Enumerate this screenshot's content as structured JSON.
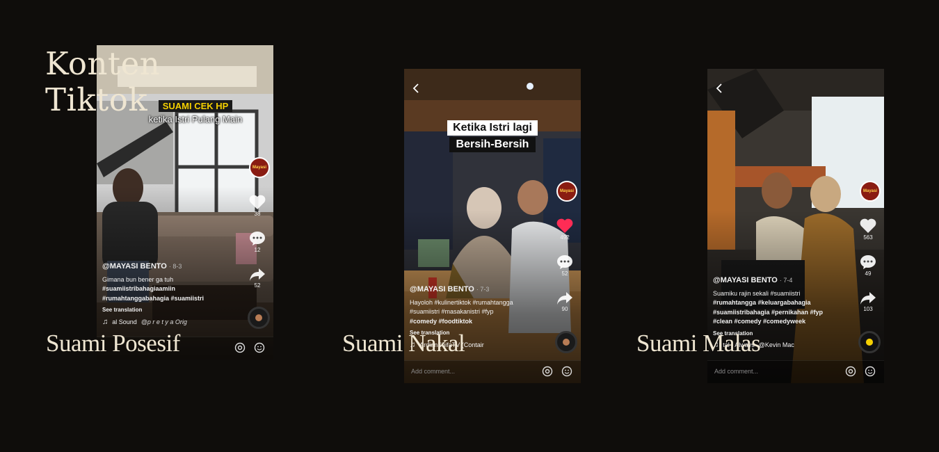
{
  "title": {
    "line1": "Konten",
    "line2": "Tiktok"
  },
  "videos": [
    {
      "caption": "Suami Posesif",
      "overlay": {
        "line1": "SUAMI CEK HP",
        "line2": "ketika Istri Pulang Main"
      },
      "avatar": "Mayasi",
      "actions": {
        "likes": "38",
        "comments": "12",
        "shares": "52"
      },
      "user": "@MAYASI BENTO",
      "date": "· 8-3",
      "desc_lines": [
        "Gimana bun bener ga tuh",
        "#suamiistribahagiaamiin",
        "#rumahtanggabahagia #suamiistri"
      ],
      "see_translation": "See translation",
      "sound": "al Sound",
      "sound_author": "@p r e t y a  Orig",
      "comment_placeholder": "",
      "colors": {
        "overlay1_bg": "#1a1a1a",
        "overlay1_fg": "#f5d000"
      }
    },
    {
      "caption": "Suami Nakal",
      "overlay": {
        "line1": "Ketika Istri lagi",
        "line2": "Bersih-Bersih"
      },
      "avatar": "Mayasi",
      "actions": {
        "likes": "492",
        "comments": "52",
        "shares": "90"
      },
      "user": "@MAYASI BENTO",
      "date": "· 7-3",
      "desc_lines": [
        "Hayoloh #kulinertiktok #rumahtangga",
        "#suamiistri #masakanistri #fyp",
        "#comedy #foodtiktok"
      ],
      "see_translation": "See translation",
      "sound": "ArdianShifaTV (Contair",
      "sound_author": "",
      "comment_placeholder": "Add comment...",
      "colors": {
        "like": "#fe2c55"
      }
    },
    {
      "caption": "Suami Malas",
      "overlay": {
        "line1": "",
        "line2": ""
      },
      "avatar": "Mayasi",
      "actions": {
        "likes": "563",
        "comments": "49",
        "shares": "103"
      },
      "user": "@MAYASI BENTO",
      "date": "· 7-4",
      "desc_lines": [
        "Suamiku rajin sekali #suamiistri",
        "#rumahtangga #keluargabahagia",
        "#suamiistribahagia #pernikahan #fyp",
        "#clean #comedy #comedyweek"
      ],
      "see_translation": "See translation",
      "sound": "tal - Always",
      "sound_author": "@Kevin Mac",
      "comment_placeholder": "Add comment...",
      "colors": {
        "disc": "#f5d000"
      }
    }
  ]
}
